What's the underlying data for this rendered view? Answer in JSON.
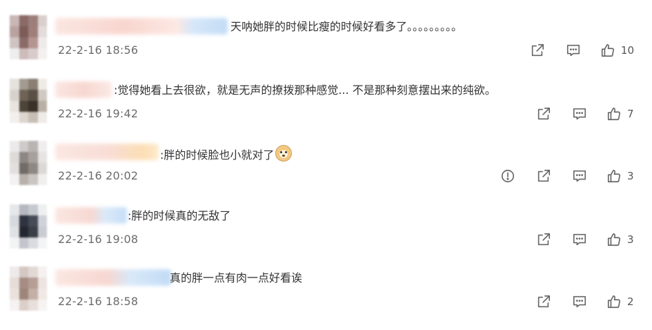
{
  "comments": [
    {
      "text": "天呐她胖的时候比瘦的时候好看多了。。。。。。。。。",
      "time": "22-2-16 18:56",
      "likes": "10",
      "show_report": false
    },
    {
      "text": ":觉得她看上去很欲，就是无声的撩拨那种感觉... 不是那种刻意摆出来的纯欲。",
      "time": "22-2-16 19:42",
      "likes": "7",
      "show_report": false
    },
    {
      "text": ":胖的时候脸也小就对了",
      "time": "22-2-16 20:02",
      "likes": "3",
      "show_report": true
    },
    {
      "text": ":胖的时候真的无敌了",
      "time": "22-2-16 19:08",
      "likes": "3",
      "show_report": false
    },
    {
      "text": "真的胖一点有肉一点好看诶",
      "time": "22-2-16 18:58",
      "likes": "2",
      "show_report": false
    }
  ],
  "icons": {
    "share": "share-icon",
    "reply": "comment-icon",
    "like": "like-icon",
    "report": "report-icon"
  },
  "colors": {
    "icon_stroke": "#666666",
    "time_text": "#6b6b6b"
  }
}
